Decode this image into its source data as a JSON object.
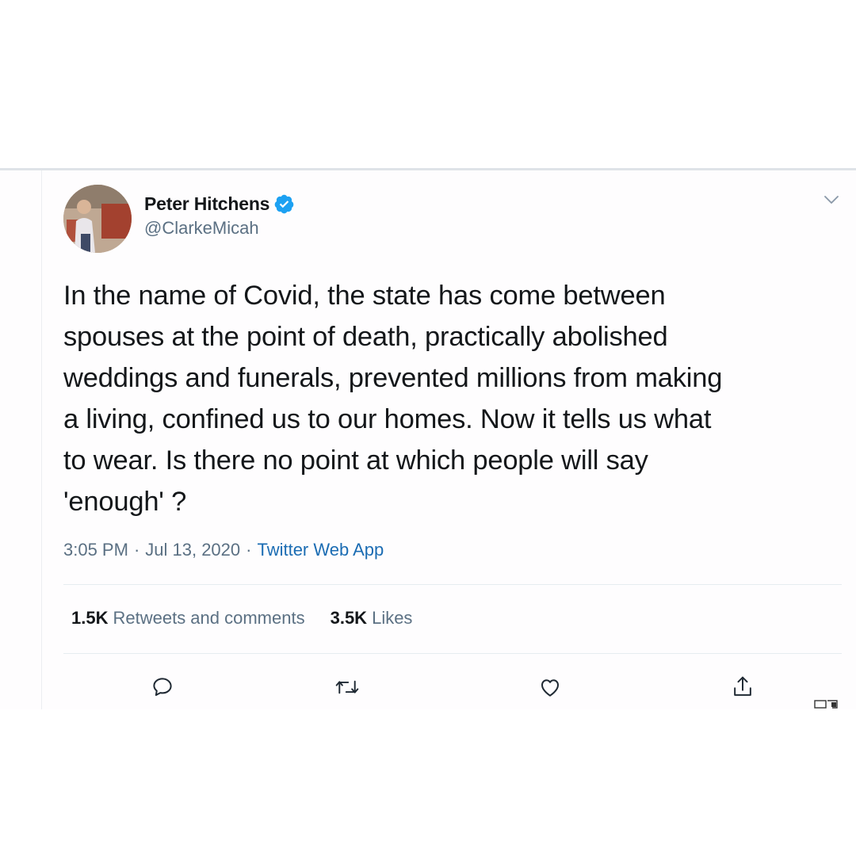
{
  "tweet": {
    "author": {
      "name": "Peter Hitchens",
      "handle": "@ClarkeMicah",
      "verified": true,
      "avatar": "profile-photo"
    },
    "text": "In the name of Covid, the state has come between\nspouses at the point of death, practically abolished\nweddings and funerals, prevented millions from making\na living, confined us to our homes. Now it tells us what\nto wear. Is there no point at which people will say\n'enough' ?",
    "time": "3:05 PM",
    "separator": "·",
    "date": "Jul 13, 2020",
    "source": "Twitter Web App",
    "stats": {
      "retweets_count": "1.5K",
      "retweets_label": "Retweets and comments",
      "likes_count": "3.5K",
      "likes_label": "Likes"
    },
    "actions": [
      {
        "name": "reply",
        "icon": "speech-bubble-icon"
      },
      {
        "name": "retweet",
        "icon": "retweet-arrows-icon"
      },
      {
        "name": "like",
        "icon": "heart-icon"
      },
      {
        "name": "share",
        "icon": "share-upload-icon"
      }
    ],
    "menu_icon": "chevron-down-icon"
  },
  "colors": {
    "text": "#14171a",
    "secondary": "#5b7083",
    "link": "#1b6cb3",
    "verified": "#1da1f2",
    "divider": "#e6ecf0"
  }
}
